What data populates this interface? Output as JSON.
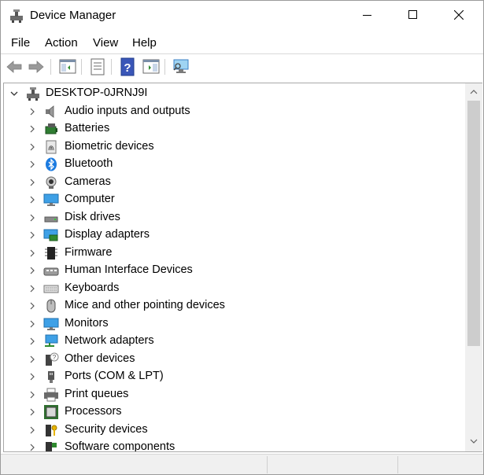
{
  "window": {
    "title": "Device Manager"
  },
  "menu": [
    "File",
    "Action",
    "View",
    "Help"
  ],
  "tree": {
    "root": "DESKTOP-0JRNJ9I",
    "items": [
      {
        "label": "Audio inputs and outputs",
        "icon": "speaker-icon"
      },
      {
        "label": "Batteries",
        "icon": "battery-icon"
      },
      {
        "label": "Biometric devices",
        "icon": "fingerprint-icon"
      },
      {
        "label": "Bluetooth",
        "icon": "bluetooth-icon"
      },
      {
        "label": "Cameras",
        "icon": "camera-icon"
      },
      {
        "label": "Computer",
        "icon": "computer-icon"
      },
      {
        "label": "Disk drives",
        "icon": "disk-drive-icon"
      },
      {
        "label": "Display adapters",
        "icon": "display-adapter-icon"
      },
      {
        "label": "Firmware",
        "icon": "firmware-chip-icon"
      },
      {
        "label": "Human Interface Devices",
        "icon": "hid-icon"
      },
      {
        "label": "Keyboards",
        "icon": "keyboard-icon"
      },
      {
        "label": "Mice and other pointing devices",
        "icon": "mouse-icon"
      },
      {
        "label": "Monitors",
        "icon": "monitor-icon"
      },
      {
        "label": "Network adapters",
        "icon": "network-adapter-icon"
      },
      {
        "label": "Other devices",
        "icon": "unknown-device-icon"
      },
      {
        "label": "Ports (COM & LPT)",
        "icon": "port-icon"
      },
      {
        "label": "Print queues",
        "icon": "printer-icon"
      },
      {
        "label": "Processors",
        "icon": "processor-icon"
      },
      {
        "label": "Security devices",
        "icon": "security-key-icon"
      },
      {
        "label": "Software components",
        "icon": "software-component-icon"
      }
    ]
  }
}
